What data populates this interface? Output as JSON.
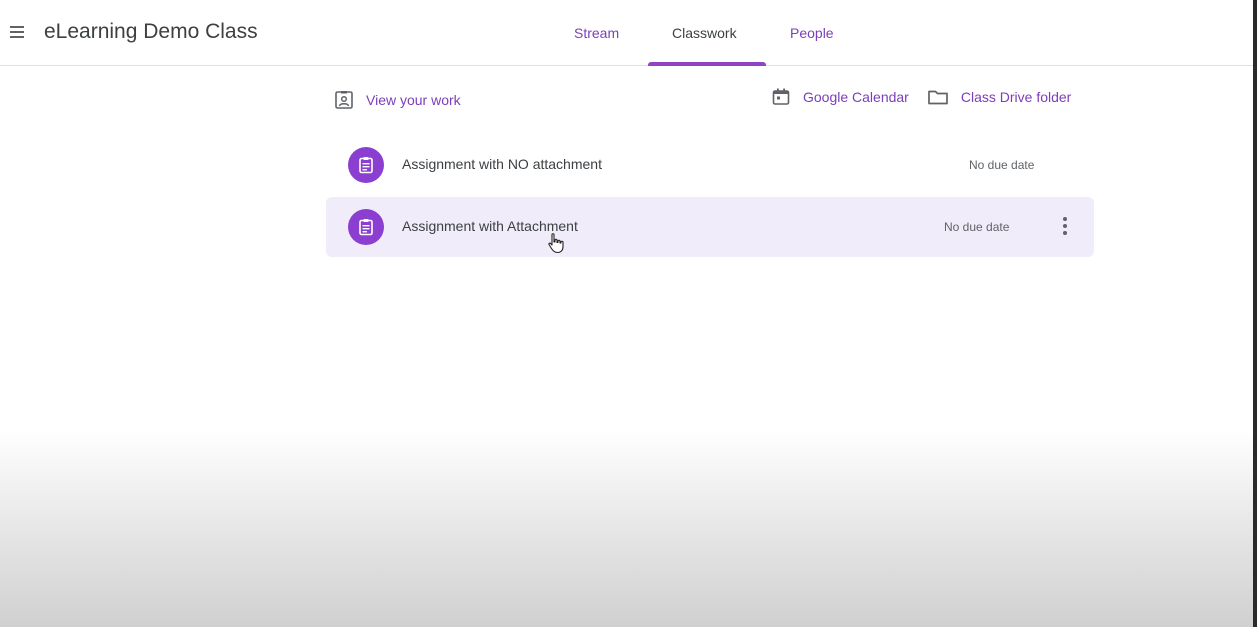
{
  "header": {
    "class_title": "eLearning Demo Class",
    "tabs": [
      {
        "label": "Stream",
        "active": false
      },
      {
        "label": "Classwork",
        "active": true
      },
      {
        "label": "People",
        "active": false
      }
    ]
  },
  "toolbar": {
    "view_work": "View your work",
    "calendar": "Google Calendar",
    "drive_folder": "Class Drive folder"
  },
  "assignments": [
    {
      "title": "Assignment with NO attachment",
      "due": "No due date",
      "hovered": false
    },
    {
      "title": "Assignment with Attachment",
      "due": "No due date",
      "hovered": true
    }
  ],
  "colors": {
    "accent": "#8a3fd1",
    "link": "#7b3fb9",
    "row_hover": "#f1ecf9"
  },
  "icons": {
    "menu": "hamburger-menu-icon",
    "view_work": "assigned-person-icon",
    "calendar": "calendar-icon",
    "drive_folder": "folder-icon",
    "assignment": "assignment-icon",
    "more": "more-vert-icon",
    "cursor": "hand-pointer-cursor-icon"
  }
}
